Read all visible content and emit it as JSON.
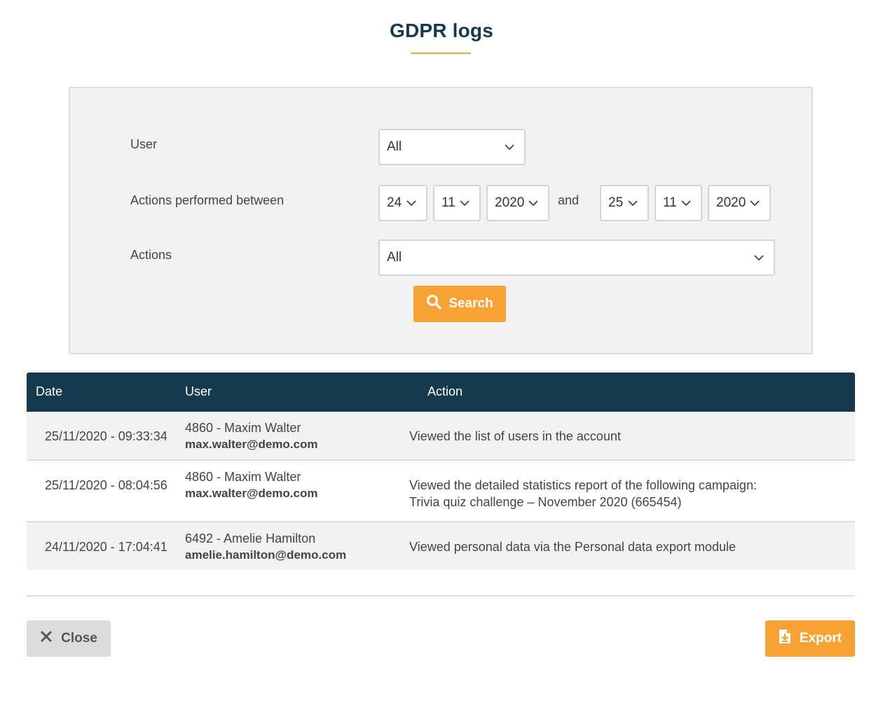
{
  "page": {
    "title": "GDPR logs"
  },
  "filters": {
    "user_label": "User",
    "user_value": "All",
    "between_label": "Actions performed between",
    "from_day": "24",
    "from_month": "11",
    "from_year": "2020",
    "and_label": "and",
    "to_day": "25",
    "to_month": "11",
    "to_year": "2020",
    "actions_label": "Actions",
    "actions_value": "All",
    "search_label": "Search"
  },
  "table": {
    "headers": {
      "date": "Date",
      "user": "User",
      "action": "Action"
    },
    "rows": [
      {
        "date": "25/11/2020 - 09:33:34",
        "user_name": "4860 - Maxim Walter",
        "user_email": "max.walter@demo.com",
        "action_line1": "Viewed the list of users in the account",
        "action_line2": ""
      },
      {
        "date": "25/11/2020 - 08:04:56",
        "user_name": "4860 - Maxim Walter",
        "user_email": "max.walter@demo.com",
        "action_line1": "Viewed the detailed statistics report of the following campaign:",
        "action_line2": "Trivia quiz challenge – November 2020 (665454)"
      },
      {
        "date": "24/11/2020 - 17:04:41",
        "user_name": "6492 - Amelie Hamilton",
        "user_email": "amelie.hamilton@demo.com",
        "action_line1": "Viewed personal data via the Personal data export module",
        "action_line2": ""
      }
    ]
  },
  "footer": {
    "close_label": "Close",
    "export_label": "Export"
  },
  "icons": {
    "chevron": "chevron-down-icon",
    "search": "search-icon",
    "close": "close-icon",
    "export": "file-download-icon"
  },
  "colors": {
    "accent": "#f7a234",
    "header_bg": "#16394d",
    "title": "#16394d"
  }
}
